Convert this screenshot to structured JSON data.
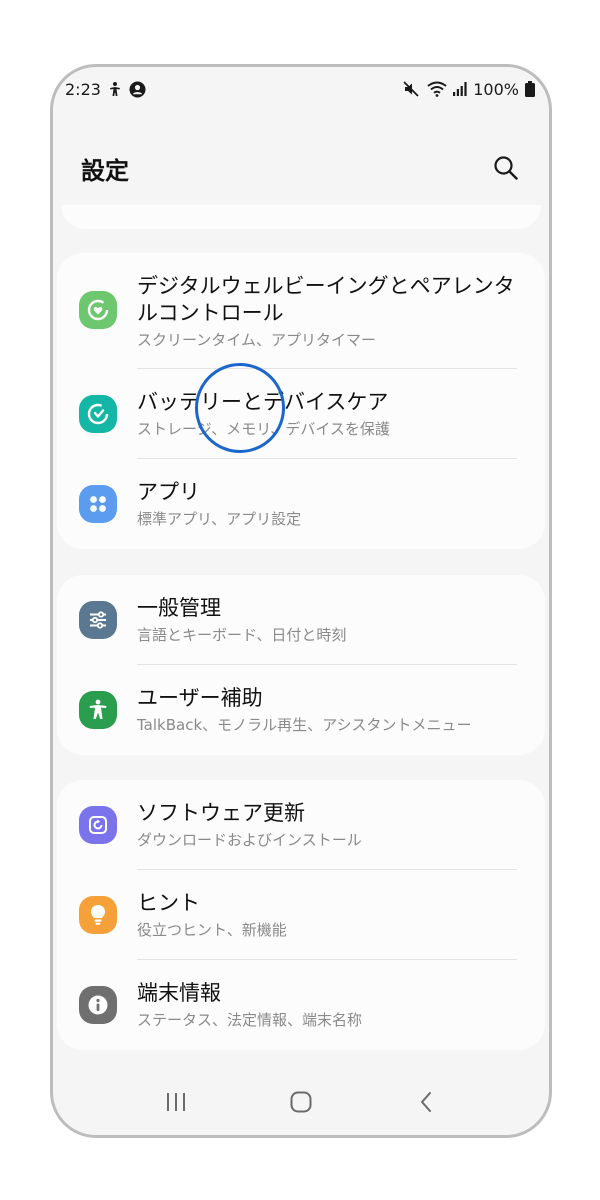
{
  "status_bar": {
    "time": "2:23",
    "battery": "100%",
    "left_icons": [
      "accessibility-person-icon",
      "account-circle-icon"
    ],
    "right_icons": [
      "mute-icon",
      "wifi-icon",
      "signal-icon",
      "battery-icon"
    ]
  },
  "header": {
    "title": "設定",
    "search_icon": "search-icon"
  },
  "groups": [
    {
      "items": [
        {
          "title_line1": "デジタルウェルビーイングとペアレンタ",
          "title_line2": "ルコントロール",
          "subtitle": "スクリーンタイム、アプリタイマー",
          "icon": "digital-wellbeing-icon",
          "color": "#6cc76e"
        },
        {
          "title": "バッテリーとデバイスケア",
          "subtitle": "ストレージ、メモリ、デバイスを保護",
          "icon": "device-care-icon",
          "color": "#14b6a6"
        },
        {
          "title": "アプリ",
          "subtitle": "標準アプリ、アプリ設定",
          "icon": "apps-icon",
          "color": "#5b9cf0"
        }
      ]
    },
    {
      "items": [
        {
          "title": "一般管理",
          "subtitle": "言語とキーボード、日付と時刻",
          "icon": "general-management-icon",
          "color": "#5a7891"
        },
        {
          "title": "ユーザー補助",
          "subtitle": "TalkBack、モノラル再生、アシスタントメニュー",
          "icon": "accessibility-icon",
          "color": "#2a9d4e"
        }
      ]
    },
    {
      "items": [
        {
          "title": "ソフトウェア更新",
          "subtitle": "ダウンロードおよびインストール",
          "icon": "software-update-icon",
          "color": "#7b73ec"
        },
        {
          "title": "ヒント",
          "subtitle": "役立つヒント、新機能",
          "icon": "tips-lightbulb-icon",
          "color": "#f6a03a"
        },
        {
          "title": "端末情報",
          "subtitle": "ステータス、法定情報、端末名称",
          "icon": "info-icon",
          "color": "#6f6f6f"
        }
      ]
    }
  ],
  "nav_bar": {
    "icons": [
      "recent-apps-icon",
      "home-icon",
      "back-icon"
    ]
  }
}
